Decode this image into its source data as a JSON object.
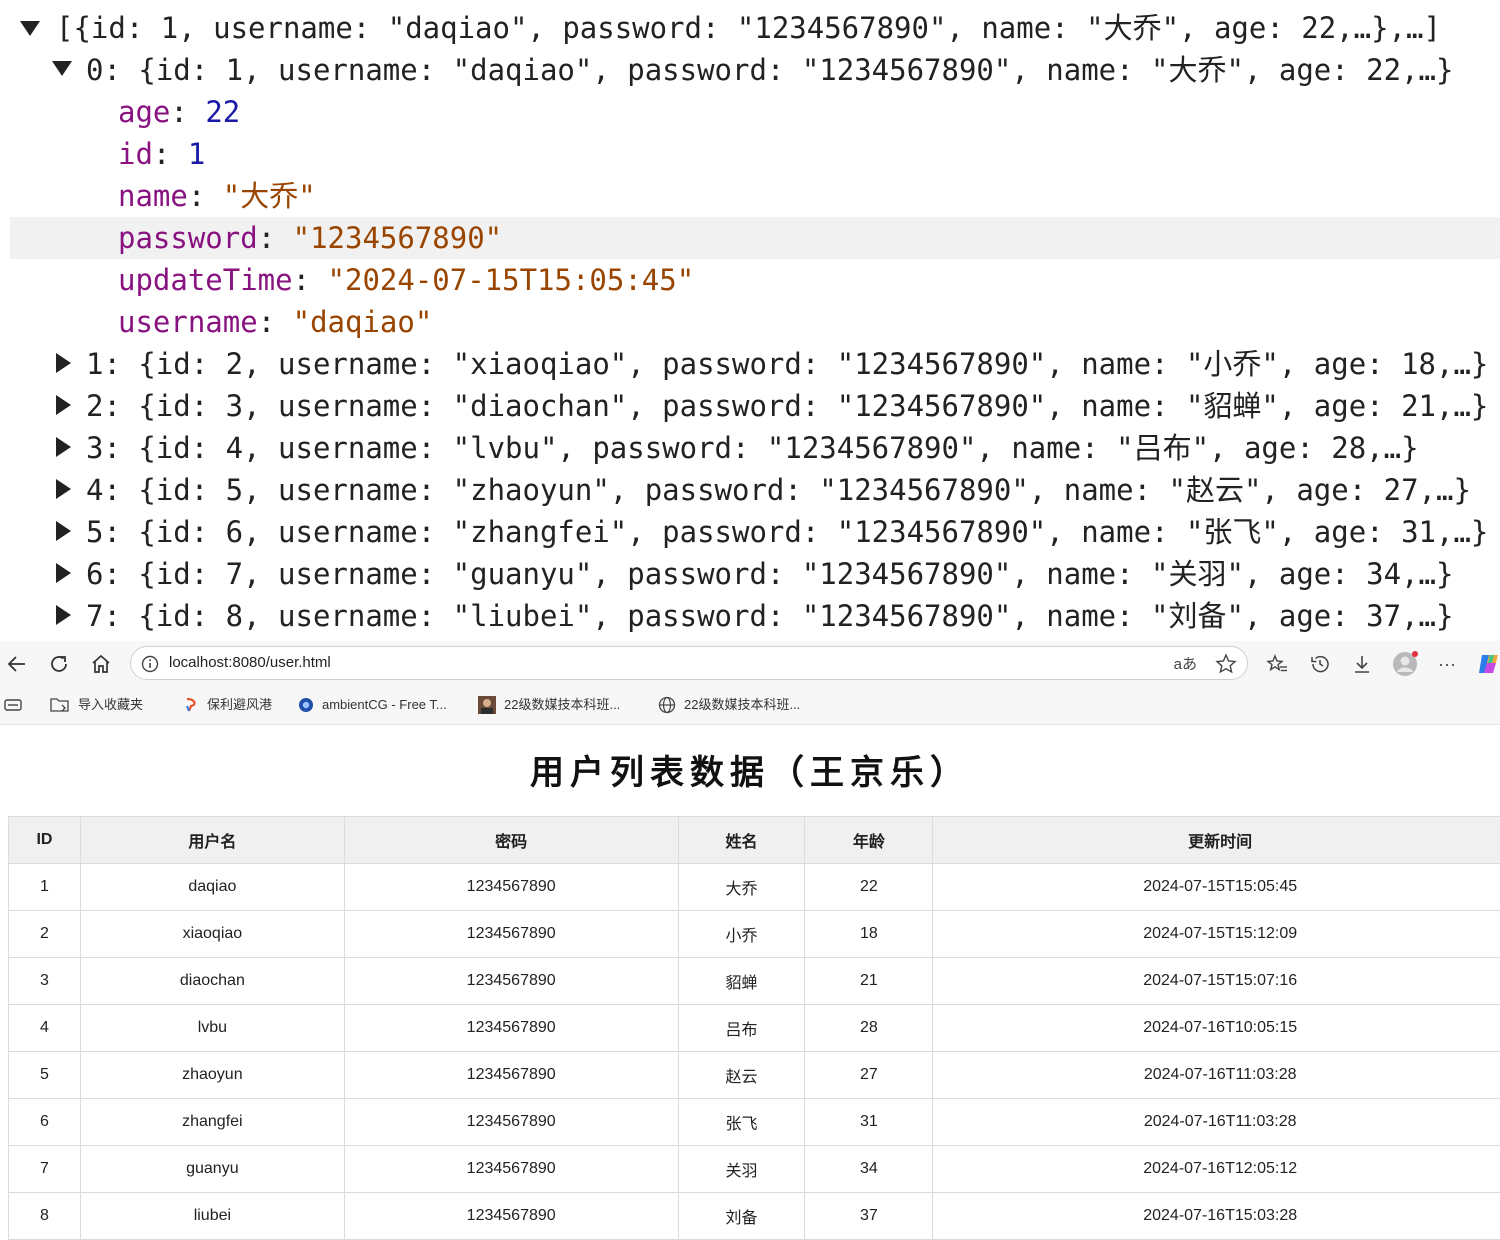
{
  "console": {
    "array_summary": "[{id: 1, username: \"daqiao\", password: \"1234567890\", name: \"大乔\", age: 22,…},…]",
    "expanded": {
      "summary": "0: {id: 1, username: \"daqiao\", password: \"1234567890\", name: \"大乔\", age: 22,…}",
      "props": [
        {
          "key": "age",
          "value": "22",
          "kind": "number"
        },
        {
          "key": "id",
          "value": "1",
          "kind": "number"
        },
        {
          "key": "name",
          "value": "\"大乔\"",
          "kind": "string"
        },
        {
          "key": "password",
          "value": "\"1234567890\"",
          "kind": "string"
        },
        {
          "key": "updateTime",
          "value": "\"2024-07-15T15:05:45\"",
          "kind": "string"
        },
        {
          "key": "username",
          "value": "\"daqiao\"",
          "kind": "string"
        }
      ]
    },
    "collapsed": [
      "1: {id: 2, username: \"xiaoqiao\", password: \"1234567890\", name: \"小乔\", age: 18,…}",
      "2: {id: 3, username: \"diaochan\", password: \"1234567890\", name: \"貂蝉\", age: 21,…}",
      "3: {id: 4, username: \"lvbu\", password: \"1234567890\", name: \"吕布\", age: 28,…}",
      "4: {id: 5, username: \"zhaoyun\", password: \"1234567890\", name: \"赵云\", age: 27,…}",
      "5: {id: 6, username: \"zhangfei\", password: \"1234567890\", name: \"张飞\", age: 31,…}",
      "6: {id: 7, username: \"guanyu\", password: \"1234567890\", name: \"关羽\", age: 34,…}",
      "7: {id: 8, username: \"liubei\", password: \"1234567890\", name: \"刘备\", age: 37,…}"
    ]
  },
  "browser": {
    "url": "localhost:8080/user.html",
    "bookmarks": [
      {
        "label": "导入收藏夹",
        "icon": "import-favorites-icon"
      },
      {
        "label": "保利避风港",
        "icon": "site-icon"
      },
      {
        "label": "ambientCG - Free T...",
        "icon": "ambientcg-icon"
      },
      {
        "label": "22级数媒技本科班...",
        "icon": "avatar-icon"
      },
      {
        "label": "22级数媒技本科班...",
        "icon": "globe-icon"
      }
    ]
  },
  "page": {
    "title": "用户列表数据（王京乐）",
    "table": {
      "headers": [
        "ID",
        "用户名",
        "密码",
        "姓名",
        "年龄",
        "更新时间"
      ],
      "rows": [
        [
          "1",
          "daqiao",
          "1234567890",
          "大乔",
          "22",
          "2024-07-15T15:05:45"
        ],
        [
          "2",
          "xiaoqiao",
          "1234567890",
          "小乔",
          "18",
          "2024-07-15T15:12:09"
        ],
        [
          "3",
          "diaochan",
          "1234567890",
          "貂蝉",
          "21",
          "2024-07-15T15:07:16"
        ],
        [
          "4",
          "lvbu",
          "1234567890",
          "吕布",
          "28",
          "2024-07-16T10:05:15"
        ],
        [
          "5",
          "zhaoyun",
          "1234567890",
          "赵云",
          "27",
          "2024-07-16T11:03:28"
        ],
        [
          "6",
          "zhangfei",
          "1234567890",
          "张飞",
          "31",
          "2024-07-16T11:03:28"
        ],
        [
          "7",
          "guanyu",
          "1234567890",
          "关羽",
          "34",
          "2024-07-16T12:05:12"
        ],
        [
          "8",
          "liubei",
          "1234567890",
          "刘备",
          "37",
          "2024-07-16T15:03:28"
        ]
      ]
    }
  }
}
